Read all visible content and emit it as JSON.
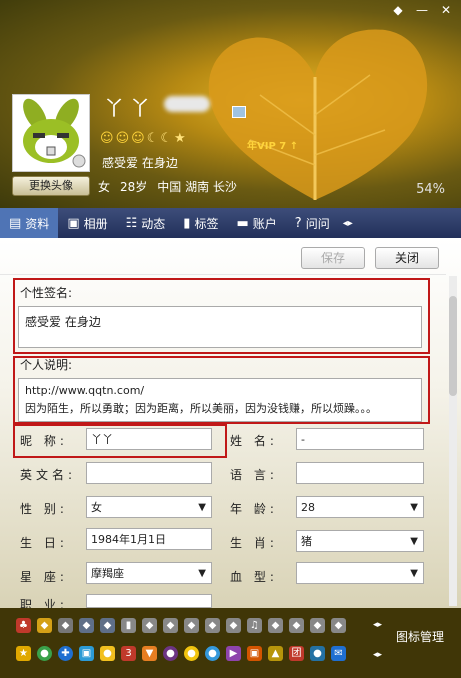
{
  "window": {
    "controls": [
      "◆",
      "—",
      "✕"
    ]
  },
  "profile": {
    "nickname": "丫丫",
    "level_icons": [
      "☺",
      "☺",
      "☺",
      "☾",
      "☾",
      "★"
    ],
    "vip_badge": "年VIP 7 ↑",
    "signature": "感受爱 在身边",
    "gender": "女",
    "age_text": "28岁",
    "location": "中国 湖南 长沙",
    "completion": "54%",
    "change_avatar_label": "更换头像"
  },
  "tabs": [
    {
      "label": "资料",
      "icon": "profile-card-icon",
      "glyph": "▤"
    },
    {
      "label": "相册",
      "icon": "photo-album-icon",
      "glyph": "▣"
    },
    {
      "label": "动态",
      "icon": "feed-icon",
      "glyph": "☷"
    },
    {
      "label": "标签",
      "icon": "bookmark-icon",
      "glyph": "▮"
    },
    {
      "label": "账户",
      "icon": "wallet-icon",
      "glyph": "▬"
    },
    {
      "label": "问问",
      "icon": "question-icon",
      "glyph": "?"
    }
  ],
  "toolbar": {
    "save_label": "保存",
    "close_label": "关闭"
  },
  "form": {
    "signature_label": "个性签名:",
    "signature_value": "感受爱 在身边",
    "description_label": "个人说明:",
    "description_line1": "http://www.qqtn.com/",
    "description_line2": "因为陌生，所以勇敢；因为距离，所以美丽，因为没钱赚，所以烦躁。。。",
    "nickname_label": "昵  称:",
    "nickname_value": "丫丫",
    "name_label": "姓  名:",
    "name_value": "-",
    "english_name_label": "英文名:",
    "english_name_value": "",
    "language_label": "语  言:",
    "language_value": "",
    "gender_label": "性  别:",
    "gender_value": "女",
    "age_label": "年  龄:",
    "age_value": "28",
    "birthday_label": "生  日:",
    "birthday_value": "1984年1月1日",
    "zodiac_label": "生  肖:",
    "zodiac_value": "猪",
    "constellation_label": "星  座:",
    "constellation_value": "摩羯座",
    "blood_label": "血  型:",
    "blood_value": "",
    "occupation_label": "职  业:"
  },
  "icon_panel": {
    "manage_label": "图标管理"
  },
  "colors": {
    "tab_bar": "#2c3a66",
    "tab_active": "#4f74b5",
    "highlight_box": "#c01818",
    "icon_panel_bg": "#403607"
  }
}
